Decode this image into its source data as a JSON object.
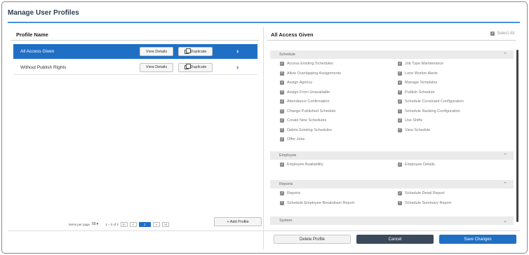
{
  "title": "Manage User Profiles",
  "left": {
    "header": "Profile Name",
    "profiles": [
      {
        "name": "All Access Given",
        "view_label": "View Details",
        "dup_label": "Duplicate",
        "selected": true
      },
      {
        "name": "Without Publish Rights",
        "view_label": "View Details",
        "dup_label": "Duplicate",
        "selected": false
      }
    ],
    "add_label": "+ Add Profile",
    "pager": {
      "items_per_page_label": "Items per page",
      "per_page": "50",
      "range": "1 – 2 of 2",
      "current_page": "1"
    }
  },
  "right": {
    "header": "All Access Given",
    "select_all": "Select All",
    "sections": [
      {
        "name": "Schedule",
        "expanded": true,
        "items": [
          "Access Existing Schedules",
          "Job Type Maintenance",
          "Allow Overlapping Assignments",
          "Lone Worker Alerts",
          "Assign Agency",
          "Manage Templates",
          "Assign From Unavailable",
          "Publish Schedule",
          "Attendance Confirmation",
          "Schedule Constraint Configuration",
          "Change Published Schedule",
          "Schedule Ranking Configuration",
          "Create New Schedules",
          "Use Shifts",
          "Delete Existing Schedules",
          "View Schedule",
          "Offer Jobs"
        ]
      },
      {
        "name": "Employee",
        "expanded": true,
        "items": [
          "Employee Availability",
          "Employee Details"
        ]
      },
      {
        "name": "Reports",
        "expanded": true,
        "items": [
          "Reports",
          "Schedule Detail Report",
          "Schedule Employee Breakdown Report",
          "Schedule Summary Report"
        ]
      },
      {
        "name": "System",
        "expanded": false,
        "items": []
      }
    ]
  },
  "footer": {
    "delete": "Delete Profile",
    "cancel": "Cancel",
    "save": "Save Changes"
  },
  "colors": {
    "accent": "#1f6fc5",
    "cancel": "#3a4a5a",
    "section_bg": "#ebebeb"
  }
}
